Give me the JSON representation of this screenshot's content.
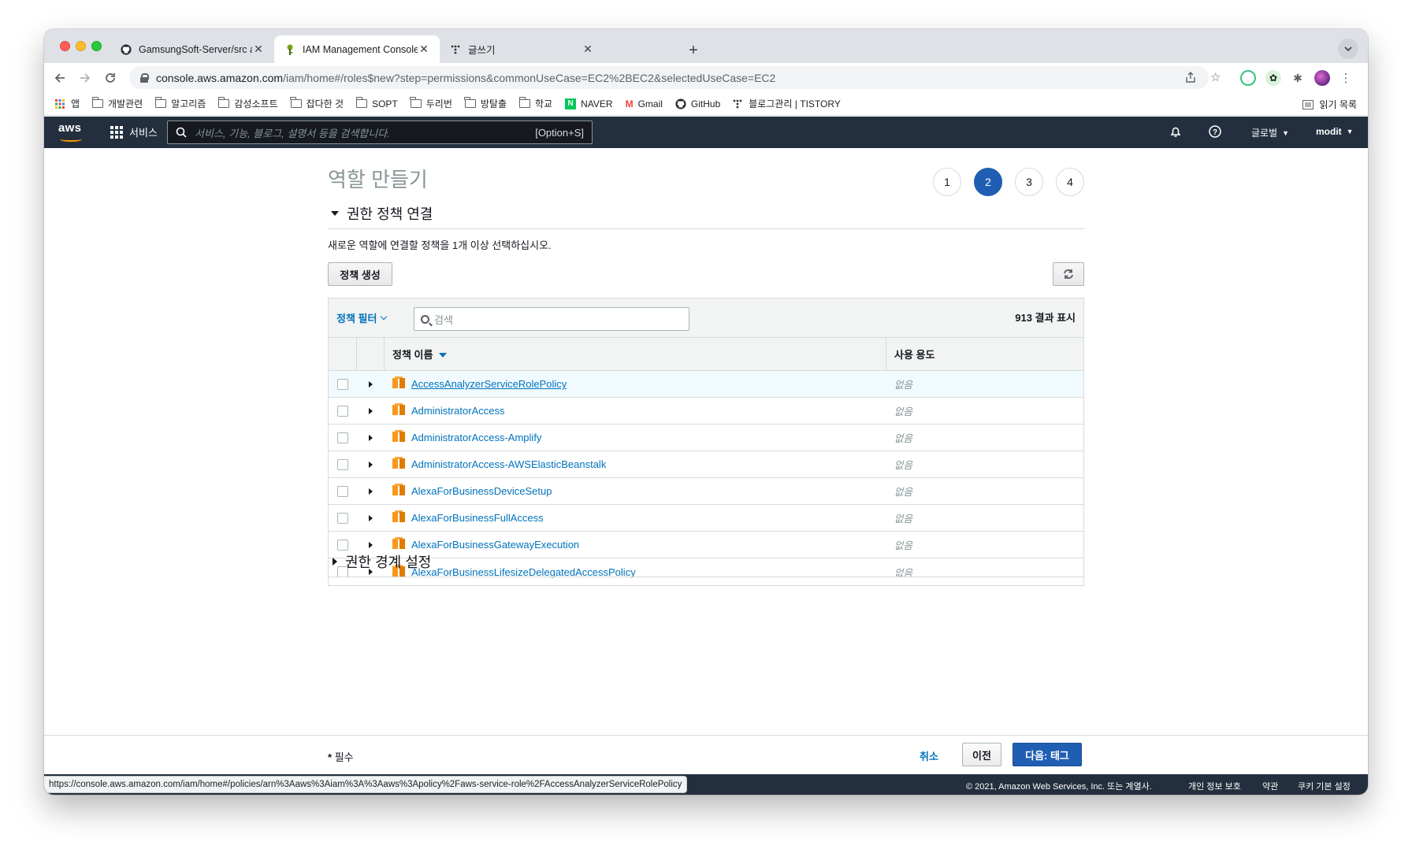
{
  "browser": {
    "tabs": [
      {
        "title": "GamsungSoft-Server/src at ma",
        "favicon": "github-icon"
      },
      {
        "title": "IAM Management Console",
        "favicon": "aws-key-icon"
      },
      {
        "title": "글쓰기",
        "favicon": "tistory-icon"
      }
    ],
    "url_host": "console.aws.amazon.com",
    "url_path": "/iam/home#/roles$new?step=permissions&commonUseCase=EC2%2BEC2&selectedUseCase=EC2",
    "bookmarks": [
      {
        "label": "앱",
        "type": "apps"
      },
      {
        "label": "개발관련",
        "type": "folder"
      },
      {
        "label": "알고리즘",
        "type": "folder"
      },
      {
        "label": "감성소프트",
        "type": "folder"
      },
      {
        "label": "잡다한 것",
        "type": "folder"
      },
      {
        "label": "SOPT",
        "type": "folder"
      },
      {
        "label": "두리번",
        "type": "folder"
      },
      {
        "label": "방탈출",
        "type": "folder"
      },
      {
        "label": "학교",
        "type": "folder"
      },
      {
        "label": "NAVER",
        "type": "naver"
      },
      {
        "label": "Gmail",
        "type": "gmail"
      },
      {
        "label": "GitHub",
        "type": "github"
      },
      {
        "label": "블로그관리 | TISTORY",
        "type": "tistory"
      }
    ],
    "reading_list": "읽기 목록",
    "status_url": "https://console.aws.amazon.com/iam/home#/policies/arn%3Aaws%3Aiam%3A%3Aaws%3Apolicy%2Faws-service-role%2FAccessAnalyzerServiceRolePolicy"
  },
  "aws_nav": {
    "logo": "aws",
    "services": "서비스",
    "search_placeholder": "서비스, 기능, 블로그, 설명서 등을 검색합니다.",
    "search_shortcut": "[Option+S]",
    "region": "글로벌",
    "account": "modit"
  },
  "page": {
    "title": "역할 만들기",
    "steps": [
      "1",
      "2",
      "3",
      "4"
    ],
    "current_step": 2,
    "section_policies": "권한 정책 연결",
    "description": "새로운 역할에 연결할 정책을 1개 이상 선택하십시오.",
    "create_policy": "정책 생성",
    "section_boundary": "권한 경계 설정"
  },
  "table": {
    "filter_label": "정책 필터",
    "search_placeholder": "검색",
    "result_count": "913 결과 표시",
    "col_name": "정책 이름",
    "col_usage": "사용 용도",
    "rows": [
      {
        "name": "AccessAnalyzerServiceRolePolicy",
        "usage": "없음"
      },
      {
        "name": "AdministratorAccess",
        "usage": "없음"
      },
      {
        "name": "AdministratorAccess-Amplify",
        "usage": "없음"
      },
      {
        "name": "AdministratorAccess-AWSElasticBeanstalk",
        "usage": "없음"
      },
      {
        "name": "AlexaForBusinessDeviceSetup",
        "usage": "없음"
      },
      {
        "name": "AlexaForBusinessFullAccess",
        "usage": "없음"
      },
      {
        "name": "AlexaForBusinessGatewayExecution",
        "usage": "없음"
      },
      {
        "name": "AlexaForBusinessLifesizeDelegatedAccessPolicy",
        "usage": "없음"
      }
    ]
  },
  "footer": {
    "required_mark": "*",
    "required": "필수",
    "cancel": "취소",
    "previous": "이전",
    "next": "다음: 태그",
    "copyright": "© 2021, Amazon Web Services, Inc. 또는 계열사.",
    "privacy": "개인 정보 보호",
    "terms": "약관",
    "cookies": "쿠키 기본 설정"
  },
  "colors": {
    "aws_nav_bg": "#232f3e",
    "aws_orange": "#ff9900",
    "link": "#0073bb",
    "primary_button": "#1f5eb2"
  }
}
